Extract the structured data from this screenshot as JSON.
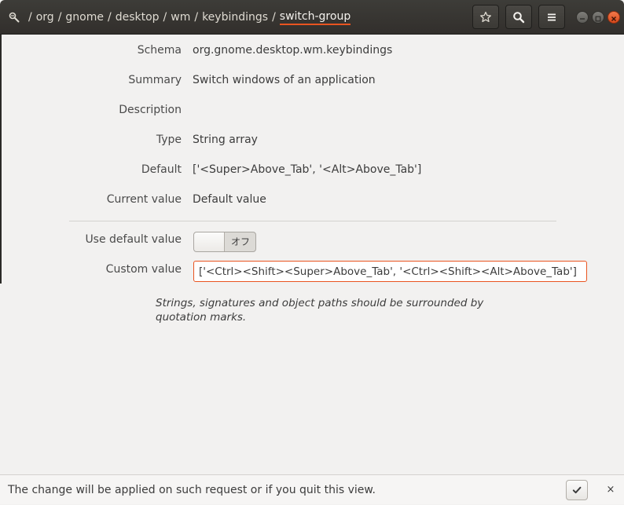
{
  "header": {
    "app_icon": "dconf-editor-icon",
    "path_segments": [
      "org",
      "gnome",
      "desktop",
      "wm",
      "keybindings",
      "switch-group"
    ],
    "path_separator": "/",
    "root_separator": "/",
    "bookmark_icon": "star-icon",
    "search_icon": "search-icon",
    "menu_icon": "hamburger-menu-icon",
    "accent_color": "#e95420"
  },
  "properties": {
    "schema_label": "Schema",
    "schema_value": "org.gnome.desktop.wm.keybindings",
    "summary_label": "Summary",
    "summary_value": "Switch windows of an application",
    "description_label": "Description",
    "description_value": "",
    "type_label": "Type",
    "type_value": "String array",
    "default_label": "Default",
    "default_value": "['<Super>Above_Tab', '<Alt>Above_Tab']",
    "current_label": "Current value",
    "current_value": "Default value"
  },
  "edit": {
    "use_default_label": "Use default value",
    "use_default_state": "オフ",
    "use_default_on": false,
    "custom_label": "Custom value",
    "custom_value": "['<Ctrl><Shift><Super>Above_Tab', '<Ctrl><Shift><Alt>Above_Tab']",
    "hint": "Strings, signatures and object paths should be surrounded by quotation marks."
  },
  "bottombar": {
    "message": "The change will be applied on such request or if you quit this view.",
    "apply_icon": "checkmark-icon",
    "dismiss_label": "×"
  }
}
